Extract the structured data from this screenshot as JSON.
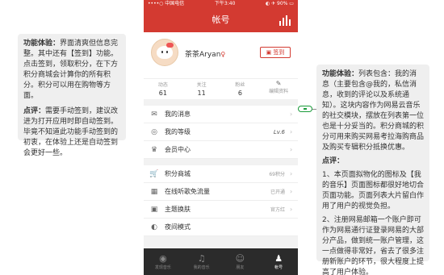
{
  "left_note": {
    "title": "功能体验：",
    "body1": "界面清爽但信息完整。其中还有【签到】功能。点击签到，领取积分，在下方积分商城会计算你的所有积分。积分可以用在购物等方面。",
    "title2": "点评：",
    "body2": "需要手动签到，建议改进为打开应用时即自动签到。毕竟不知道此功能手动签到的初衷，在体验上还是自动签到会更好一些。"
  },
  "right_note": {
    "title": "功能体验：",
    "body1": "列表包含：我的消息（主要包含@我的，私信消息，收到的评论以及系统通知）。这块内容作为网易云音乐的社交模块，摆放在列表第一位也是十分妥当的。积分商城的积分可用来购买网易考拉海购商品及购买专辑积分抵换优惠。",
    "title2": "点评：",
    "body2": "1、本页面拟物化的图标及【我的音乐】页面图标都很好地切合页面功能。页面列表大片留白作用了用户的视觉负担。",
    "body3": "2、注册网易邮箱一个账户即可作为网易通行证登录网易的大部分产品，做到统一账户管理，这一点做得非常好，省去了很多注册新账户的环节，很大程度上提高了用户体验。"
  },
  "status_bar": {
    "carrier": "••••○ 中国电信 ",
    "time": "下午3:40",
    "battery": "◐ ✈ 90% ▭"
  },
  "app_title": "帐号",
  "profile": {
    "username": "茶茶Aryan",
    "level_mark": "♀",
    "signin_label": "签到"
  },
  "stats": [
    {
      "label": "动态",
      "value": "61"
    },
    {
      "label": "关注",
      "value": "11"
    },
    {
      "label": "粉丝",
      "value": "6"
    },
    {
      "label": "编辑资料",
      "value": ""
    }
  ],
  "menu_group1": [
    {
      "icon": "✉",
      "label": "我的消息",
      "right": ""
    },
    {
      "icon": "◎",
      "label": "我的等级",
      "right": "Lv.6"
    },
    {
      "icon": "♛",
      "label": "会员中心",
      "right": ""
    }
  ],
  "menu_group2": [
    {
      "icon": "🛒",
      "label": "积分商城",
      "right": "69积分"
    },
    {
      "icon": "▦",
      "label": "在线听歌免流量",
      "right": "已开通"
    },
    {
      "icon": "▣",
      "label": "主题换肤",
      "right": "官方红"
    },
    {
      "icon": "◐",
      "label": "夜间模式",
      "right": ""
    }
  ],
  "tabs": [
    {
      "icon": "◉",
      "label": "发现音乐"
    },
    {
      "icon": "♫",
      "label": "我的音乐"
    },
    {
      "icon": "☺",
      "label": "朋友"
    },
    {
      "icon": "♟",
      "label": "帐号"
    }
  ],
  "colors": {
    "accent": "#d33a31",
    "tabbar": "#2b2b2b"
  }
}
